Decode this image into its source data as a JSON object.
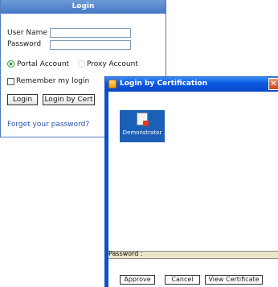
{
  "login": {
    "title": "Login",
    "username_label": "User Name",
    "password_label": "Password",
    "username_value": "",
    "password_value": "",
    "account_types": [
      "Portal Account",
      "Proxy Account"
    ],
    "selected_account": "Portal Account",
    "remember_label": "Remember my login",
    "remember_checked": false,
    "login_button": "Login",
    "cert_button": "Login by Cert",
    "forgot_link": "Forget your password?"
  },
  "cert_window": {
    "title": "Login by Certification",
    "close_glyph": "✕",
    "certificates": [
      {
        "name": "Demonstrator",
        "icon": "certificate-icon",
        "selected": true
      }
    ],
    "password_label": "Password :",
    "buttons": {
      "approve": "Approve",
      "cancel": "Cancel",
      "view": "View Certificate"
    }
  },
  "colors": {
    "login_header": "#4478c4",
    "window_titlebar": "#0a5ae0",
    "selected_item": "#1c5fb6",
    "password_bar": "#ede6c9",
    "close_button": "#d3441a"
  }
}
